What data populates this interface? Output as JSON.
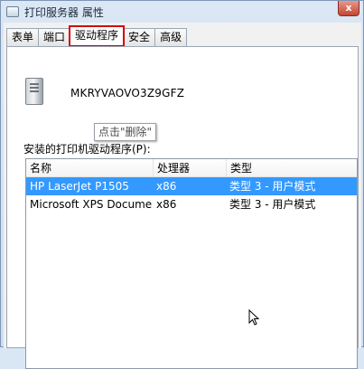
{
  "window": {
    "title": "打印服务器 属性",
    "close_label": "x"
  },
  "tabs": [
    {
      "label": "表单",
      "active": false
    },
    {
      "label": "端口",
      "active": false
    },
    {
      "label": "驱动程序",
      "active": true
    },
    {
      "label": "安全",
      "active": false
    },
    {
      "label": "高级",
      "active": false
    }
  ],
  "server": {
    "name": "MKRYVAOVO3Z9GFZ"
  },
  "tooltip": {
    "text": "点击\"删除\""
  },
  "drivers": {
    "label": "安装的打印机驱动程序(P):",
    "columns": [
      "名称",
      "处理器",
      "类型"
    ],
    "rows": [
      {
        "name": "HP LaserJet P1505",
        "processor": "x86",
        "type": "类型 3 - 用户模式",
        "selected": true
      },
      {
        "name": "Microsoft XPS Docume...",
        "processor": "x86",
        "type": "类型 3 - 用户模式",
        "selected": false
      }
    ]
  },
  "colors": {
    "selection": "#3399ff",
    "highlight_border": "#d40000"
  }
}
